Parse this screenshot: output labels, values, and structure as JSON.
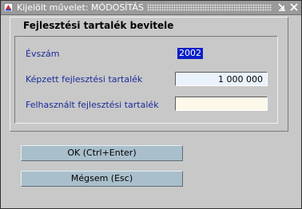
{
  "window": {
    "title": "Kijelölt művelet: MÓDOSÍTÁS",
    "app_icon": "app-icon",
    "minimize_icon": "minimize-icon",
    "close_icon": "close-icon"
  },
  "form": {
    "heading": "Fejlesztési tartalék bevitele",
    "fields": [
      {
        "label": "Évszám",
        "value": "2002"
      },
      {
        "label": "Képzett fejlesztési tartalék",
        "value": "1 000 000"
      },
      {
        "label": "Felhasznált fejlesztési tartalék",
        "value": ""
      }
    ]
  },
  "buttons": {
    "ok": "OK (Ctrl+Enter)",
    "cancel": "Mégsem (Esc)"
  },
  "colors": {
    "label_text": "#1a2b9a",
    "selection": "#0a1fc8",
    "input_active": "#eaf2fb",
    "input_empty": "#fdf9ea",
    "button_face": "#a9bfcb"
  }
}
